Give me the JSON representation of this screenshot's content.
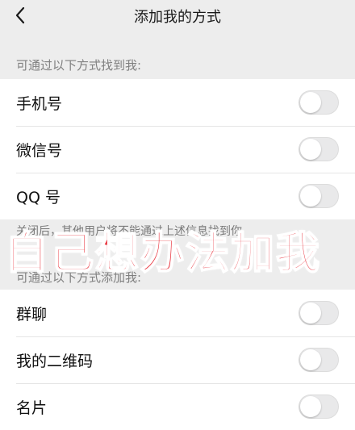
{
  "nav": {
    "title": "添加我的方式",
    "back_icon": "chevron-left-icon"
  },
  "section_find": {
    "label": "可通过以下方式找到我:",
    "items": [
      {
        "label": "手机号",
        "enabled": false
      },
      {
        "label": "微信号",
        "enabled": false
      },
      {
        "label": "QQ 号",
        "enabled": false
      }
    ],
    "note": "关闭后，其他用户将不能通过上述信息找到你"
  },
  "section_add": {
    "label": "可通过以下方式添加我:",
    "items": [
      {
        "label": "群聊",
        "enabled": false
      },
      {
        "label": "我的二维码",
        "enabled": false
      },
      {
        "label": "名片",
        "enabled": false
      }
    ]
  },
  "overlay": {
    "text": "自己想办法加我",
    "color": "#e8303a"
  }
}
